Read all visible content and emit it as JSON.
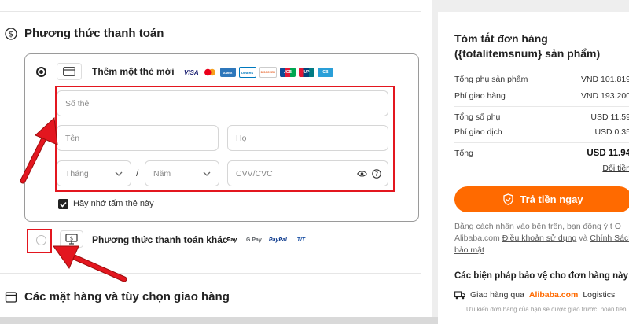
{
  "payment_section": {
    "title": "Phương thức thanh toán",
    "new_card": {
      "label": "Thêm một thẻ mới",
      "brands": [
        "VISA",
        "MC",
        "AMEX",
        "DINERS",
        "DISCOVER",
        "JCB",
        "UP",
        "CB"
      ]
    },
    "fields": {
      "card_number": "Số thẻ",
      "first_name": "Tên",
      "last_name": "Họ",
      "month": "Tháng",
      "separator": "/",
      "year": "Năm",
      "cvv": "CVV/CVC"
    },
    "remember_card": "Hãy nhớ tấm thẻ này",
    "other_methods": {
      "label": "Phương thức thanh toán khác",
      "brands": [
        "Pay",
        "G Pay",
        "PayPal",
        "T/T"
      ]
    }
  },
  "items_section": {
    "title": "Các mặt hàng và tùy chọn giao hàng"
  },
  "summary": {
    "title": "Tóm tắt đơn hàng ({totalitemsnum} sản phẩm)",
    "rows": [
      {
        "label": "Tổng phụ sản phẩm",
        "value": "VND 101.819"
      },
      {
        "label": "Phí giao hàng",
        "value": "VND 193.200"
      },
      {
        "label": "Tổng số phụ",
        "value": "USD 11.59"
      },
      {
        "label": "Phí giao dịch",
        "value": "USD 0.35"
      }
    ],
    "total_label": "Tổng",
    "total_value": "USD 11.94",
    "currency_link": "Đổi tiền",
    "pay_button": "Trả tiền ngay",
    "terms_prefix": "Bằng cách nhấn vào bên trên, bạn đồng ý t O Alibaba.com",
    "terms_link1": "Điều khoản sử dụng",
    "terms_and": "và",
    "terms_link2": "Chính Sách bảo mật",
    "protection_title": "Các biện pháp bảo vệ cho đơn hàng này",
    "shipping_prefix": "Giao hàng qua",
    "shipping_brand": "Alibaba.com",
    "shipping_suffix": "Logistics",
    "shipping_sub": "Ưu kiến đơn hàng của bạn sẽ được giao trước, hoàn tiền"
  },
  "colors": {
    "accent": "#ff6a00",
    "highlight": "#e3161f"
  }
}
